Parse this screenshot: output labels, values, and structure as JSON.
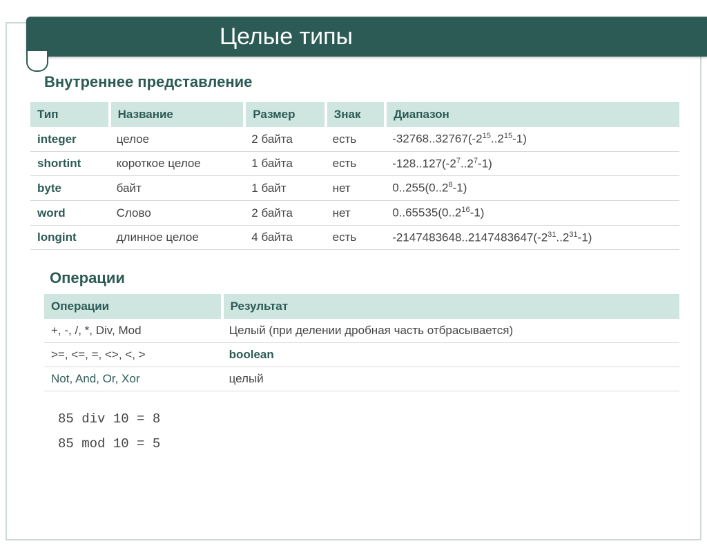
{
  "header": {
    "title": "Целые типы"
  },
  "section1": {
    "title": "Внутреннее представление"
  },
  "types_table": {
    "headers": {
      "c0": "Тип",
      "c1": "Название",
      "c2": "Размер",
      "c3": "Знак",
      "c4": "Диапазон"
    },
    "rows": [
      {
        "c0": "integer",
        "c1": "целое",
        "c2": "2 байта",
        "c3": "есть",
        "c4_pre": "-32768..32767(-2",
        "c4_s1": "15",
        "c4_mid": "..2",
        "c4_s2": "15",
        "c4_post": "-1)"
      },
      {
        "c0": "shortint",
        "c1": "короткое целое",
        "c2": "1 байта",
        "c3": "есть",
        "c4_pre": "-128..127(-2",
        "c4_s1": "7",
        "c4_mid": "..2",
        "c4_s2": "7",
        "c4_post": "-1)"
      },
      {
        "c0": "byte",
        "c1": "байт",
        "c2": "1 байт",
        "c3": "нет",
        "c4_pre": "0..255(0..2",
        "c4_s1": "8",
        "c4_mid": "",
        "c4_s2": "",
        "c4_post": "-1)"
      },
      {
        "c0": "word",
        "c1": "Слово",
        "c2": "2 байта",
        "c3": "нет",
        "c4_pre": "0..65535(0..2",
        "c4_s1": "16",
        "c4_mid": "",
        "c4_s2": "",
        "c4_post": "-1)"
      },
      {
        "c0": "longint",
        "c1": "длинное целое",
        "c2": "4 байта",
        "c3": "есть",
        "c4_pre": "-2147483648..2147483647(-2",
        "c4_s1": "31",
        "c4_mid": "..2",
        "c4_s2": "31",
        "c4_post": "-1)"
      }
    ]
  },
  "section2": {
    "title": "Операции"
  },
  "ops_table": {
    "headers": {
      "c0": "Операции",
      "c1": "Результат"
    },
    "rows": [
      {
        "c0": "+, -, /, *, Div, Mod",
        "c1": "Целый (при делении дробная часть отбрасывается)",
        "c0_green": false,
        "c1_green": false
      },
      {
        "c0": ">=, <=, =, <>, <, >",
        "c1": "boolean",
        "c0_green": false,
        "c1_green": true
      },
      {
        "c0": "Not, And, Or, Xor",
        "c1": "целый",
        "c0_green": true,
        "c1_green": false
      }
    ]
  },
  "examples": {
    "line1": "85 div 10 = 8",
    "line2": "85 mod 10 = 5"
  }
}
